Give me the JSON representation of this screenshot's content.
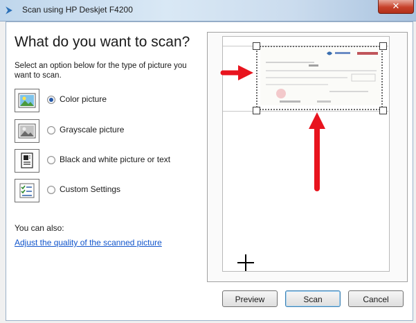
{
  "window": {
    "title": "Scan using HP Deskjet F4200",
    "icon": "scanner-icon",
    "close_label": "✕"
  },
  "heading": "What do you want to scan?",
  "instructions": "Select an option below for the type of picture you want to scan.",
  "options": [
    {
      "label": "Color picture",
      "icon": "color-picture-icon",
      "selected": true
    },
    {
      "label": "Grayscale picture",
      "icon": "grayscale-picture-icon",
      "selected": false
    },
    {
      "label": "Black and white picture or text",
      "icon": "black-white-text-icon",
      "selected": false
    },
    {
      "label": "Custom Settings",
      "icon": "custom-settings-icon",
      "selected": false
    }
  ],
  "also_label": "You can also:",
  "quality_link": "Adjust the quality of the scanned picture",
  "buttons": {
    "preview": "Preview",
    "scan": "Scan",
    "cancel": "Cancel"
  },
  "colors": {
    "accent": "#2457a8",
    "link": "#1155cc",
    "annotation_arrow": "#e8141e"
  }
}
